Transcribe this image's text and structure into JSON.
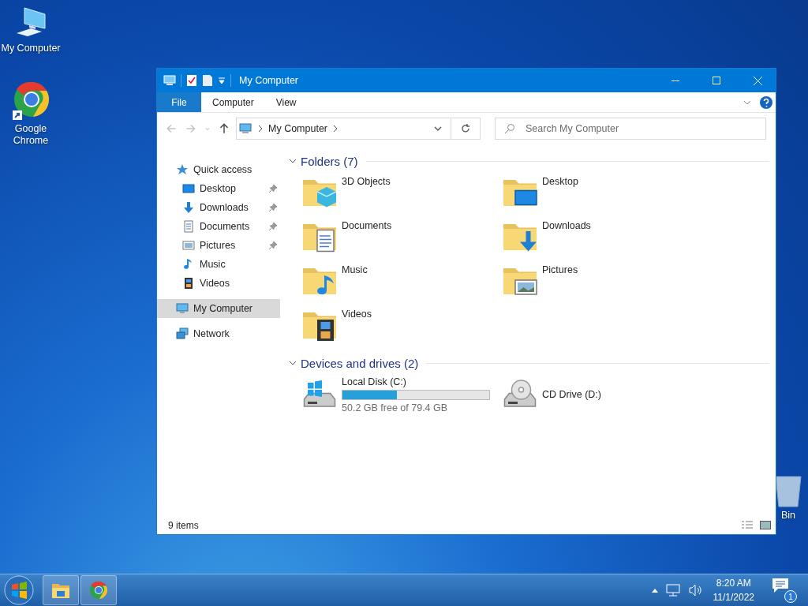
{
  "desktop_icons": [
    {
      "label": "My Computer",
      "kind": "computer"
    },
    {
      "label": "Google Chrome",
      "kind": "chrome"
    },
    {
      "label": "Bin",
      "kind": "recycle"
    }
  ],
  "window": {
    "title": "My Computer",
    "ribbon_tabs": [
      {
        "label": "File",
        "kind": "menu"
      },
      {
        "label": "Computer",
        "kind": "tab"
      },
      {
        "label": "View",
        "kind": "tab"
      }
    ],
    "nav_buttons": [
      {
        "kind": "back",
        "disabled": true
      },
      {
        "kind": "forward",
        "disabled": true
      },
      {
        "kind": "recent",
        "disabled": true
      },
      {
        "kind": "up",
        "disabled": false
      }
    ],
    "address": {
      "path": "My Computer"
    },
    "search": {
      "placeholder": "Search My Computer"
    },
    "navigation": [
      {
        "label": "Quick access",
        "kind": "star",
        "selected": false,
        "children": [
          {
            "label": "Desktop",
            "kind": "desktop",
            "pinned": true,
            "selected": false
          },
          {
            "label": "Downloads",
            "kind": "downloads",
            "pinned": true,
            "selected": false
          },
          {
            "label": "Documents",
            "kind": "documents",
            "pinned": true,
            "selected": false
          },
          {
            "label": "Pictures",
            "kind": "pictures",
            "pinned": true,
            "selected": false
          },
          {
            "label": "Music",
            "kind": "music",
            "pinned": false,
            "selected": false
          },
          {
            "label": "Videos",
            "kind": "videos",
            "pinned": false,
            "selected": false
          }
        ]
      },
      {
        "label": "My Computer",
        "kind": "computer",
        "selected": true
      },
      {
        "label": "Network",
        "kind": "network",
        "selected": false
      }
    ],
    "sections": [
      {
        "title": "Folders (7)",
        "expanded": true,
        "items": [
          {
            "name": "3D Objects",
            "kind": "objects3d"
          },
          {
            "name": "Desktop",
            "kind": "desktop"
          },
          {
            "name": "Documents",
            "kind": "documents"
          },
          {
            "name": "Downloads",
            "kind": "downloads"
          },
          {
            "name": "Music",
            "kind": "music"
          },
          {
            "name": "Pictures",
            "kind": "pictures"
          },
          {
            "name": "Videos",
            "kind": "videos"
          }
        ]
      },
      {
        "title": "Devices and drives (2)",
        "expanded": true,
        "items": [
          {
            "name": "Local Disk (C:)",
            "kind": "disk",
            "level": 0.37,
            "free": "50.2 GB free of 79.4 GB"
          },
          {
            "name": "CD Drive (D:)",
            "kind": "cd"
          }
        ]
      }
    ],
    "status_bar": "9 items"
  },
  "taskbar": {
    "apps": [
      {
        "kind": "explorer",
        "active": true
      },
      {
        "kind": "chrome",
        "active": true
      }
    ],
    "time": "8:20 AM",
    "date": "11/1/2022",
    "notifications": "1"
  }
}
